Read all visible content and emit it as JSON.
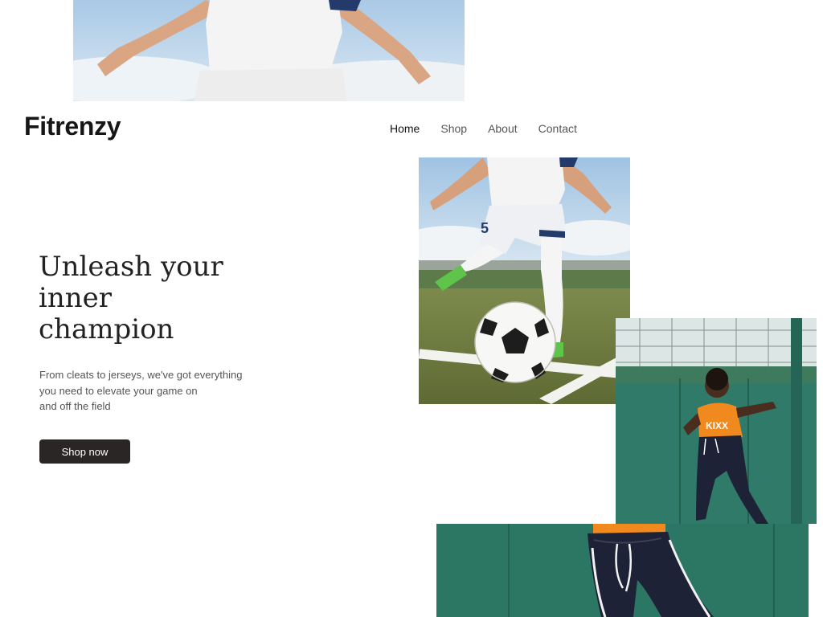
{
  "brand": {
    "name": "Fitrenzy"
  },
  "nav": {
    "items": [
      {
        "label": "Home",
        "active": true
      },
      {
        "label": "Shop",
        "active": false
      },
      {
        "label": "About",
        "active": false
      },
      {
        "label": "Contact",
        "active": false
      }
    ]
  },
  "hero": {
    "headline": "Unleash your inner champion",
    "subtext": "From cleats to jerseys, we've got everything\nyou need to elevate your game on\nand off the field",
    "cta_label": "Shop now"
  },
  "images": {
    "top": "soccer-player-white-kit-photo",
    "main": "soccer-ball-cleat-pitch-photo",
    "kid": "kid-orange-jersey-photo",
    "bottom": "kid-navy-trackpants-photo"
  },
  "jersey": {
    "print": "KIXX",
    "number": "5"
  },
  "colors": {
    "cta_background": "#2a2626",
    "jersey_orange": "#f08a1f",
    "wall_green": "#2f7a68",
    "grass_green": "#6d7a3e"
  }
}
